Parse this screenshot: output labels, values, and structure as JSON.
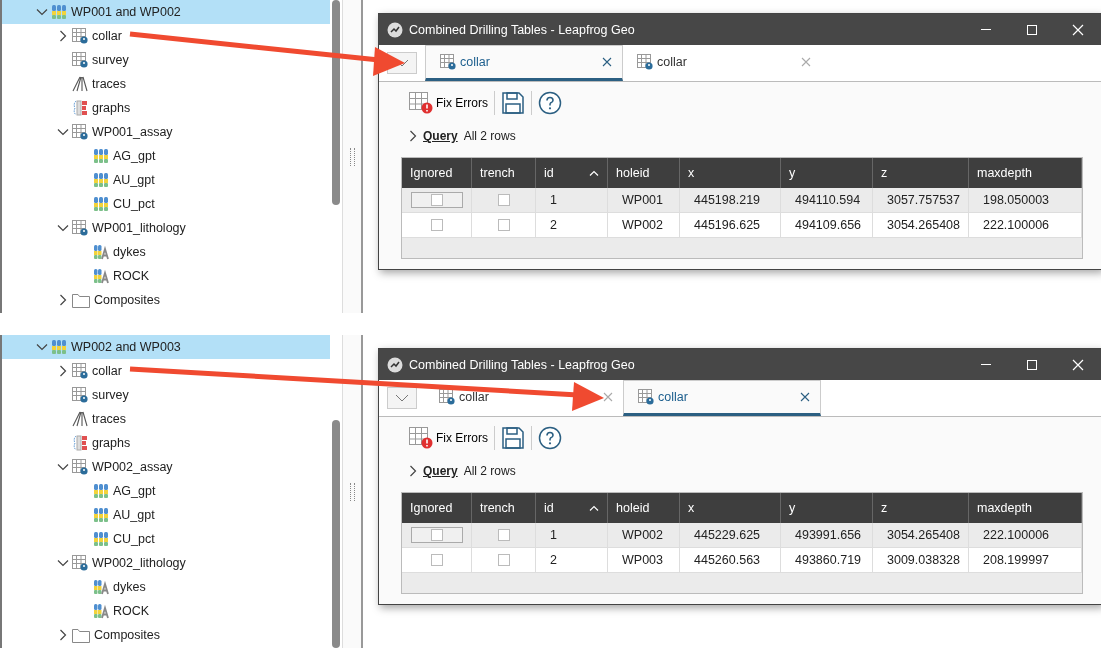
{
  "panels": [
    {
      "tree": [
        {
          "label": "WP001 and WP002",
          "kind": "drillholes",
          "expanded": true,
          "selected": true,
          "children": [
            {
              "label": "collar",
              "kind": "table",
              "expanded": false,
              "selected": false
            },
            {
              "label": "survey",
              "kind": "table",
              "selected": false
            },
            {
              "label": "traces",
              "kind": "traces",
              "selected": false
            },
            {
              "label": "graphs",
              "kind": "graphs",
              "selected": false
            },
            {
              "label": "WP001_assay",
              "kind": "table",
              "expanded": true,
              "selected": false,
              "children": [
                {
                  "label": "AG_gpt",
                  "kind": "numeric",
                  "selected": false
                },
                {
                  "label": "AU_gpt",
                  "kind": "numeric",
                  "selected": false
                },
                {
                  "label": "CU_pct",
                  "kind": "numeric",
                  "selected": false
                }
              ]
            },
            {
              "label": "WP001_lithology",
              "kind": "table",
              "expanded": true,
              "selected": false,
              "children": [
                {
                  "label": "dykes",
                  "kind": "category",
                  "selected": false
                },
                {
                  "label": "ROCK",
                  "kind": "category",
                  "selected": false
                }
              ]
            },
            {
              "label": "Composites",
              "kind": "folder",
              "expanded": false,
              "selected": false
            }
          ]
        }
      ],
      "window": {
        "title": "Combined Drilling Tables - Leapfrog Geo",
        "tabs": [
          {
            "label": "collar",
            "selected": true
          },
          {
            "label": "collar",
            "selected": false
          }
        ],
        "toolbar": {
          "fix_errors": "Fix Errors"
        },
        "query": {
          "label": "Query",
          "summary": "All 2 rows"
        },
        "table": {
          "check_columns": [
            "Ignored",
            "trench"
          ],
          "columns": [
            "id",
            "holeid",
            "x",
            "y",
            "z",
            "maxdepth"
          ],
          "rows": [
            {
              "selected": true,
              "ignored": false,
              "trench": false,
              "cells": [
                "1",
                "WP001",
                "445198.219",
                "494110.594",
                "3057.757537",
                "198.050003"
              ]
            },
            {
              "selected": false,
              "ignored": false,
              "trench": false,
              "cells": [
                "2",
                "WP002",
                "445196.625",
                "494109.656",
                "3054.265408",
                "222.100006"
              ]
            }
          ]
        }
      }
    },
    {
      "tree": [
        {
          "label": "WP002 and WP003",
          "kind": "drillholes",
          "expanded": true,
          "selected": true,
          "children": [
            {
              "label": "collar",
              "kind": "table",
              "expanded": false,
              "selected": false
            },
            {
              "label": "survey",
              "kind": "table",
              "selected": false
            },
            {
              "label": "traces",
              "kind": "traces",
              "selected": false
            },
            {
              "label": "graphs",
              "kind": "graphs",
              "selected": false
            },
            {
              "label": "WP002_assay",
              "kind": "table",
              "expanded": true,
              "selected": false,
              "children": [
                {
                  "label": "AG_gpt",
                  "kind": "numeric",
                  "selected": false
                },
                {
                  "label": "AU_gpt",
                  "kind": "numeric",
                  "selected": false
                },
                {
                  "label": "CU_pct",
                  "kind": "numeric",
                  "selected": false
                }
              ]
            },
            {
              "label": "WP002_lithology",
              "kind": "table",
              "expanded": true,
              "selected": false,
              "children": [
                {
                  "label": "dykes",
                  "kind": "category",
                  "selected": false
                },
                {
                  "label": "ROCK",
                  "kind": "category",
                  "selected": false
                }
              ]
            },
            {
              "label": "Composites",
              "kind": "folder",
              "expanded": false,
              "selected": false
            }
          ]
        }
      ],
      "window": {
        "title": "Combined Drilling Tables - Leapfrog Geo",
        "tabs": [
          {
            "label": "collar",
            "selected": false
          },
          {
            "label": "collar",
            "selected": true
          }
        ],
        "toolbar": {
          "fix_errors": "Fix Errors"
        },
        "query": {
          "label": "Query",
          "summary": "All 2 rows"
        },
        "table": {
          "check_columns": [
            "Ignored",
            "trench"
          ],
          "columns": [
            "id",
            "holeid",
            "x",
            "y",
            "z",
            "maxdepth"
          ],
          "rows": [
            {
              "selected": true,
              "ignored": false,
              "trench": false,
              "cells": [
                "1",
                "WP002",
                "445229.625",
                "493991.656",
                "3054.265408",
                "222.100006"
              ]
            },
            {
              "selected": false,
              "ignored": false,
              "trench": false,
              "cells": [
                "2",
                "WP003",
                "445260.563",
                "493860.719",
                "3009.038328",
                "208.199997"
              ]
            }
          ]
        }
      }
    }
  ]
}
